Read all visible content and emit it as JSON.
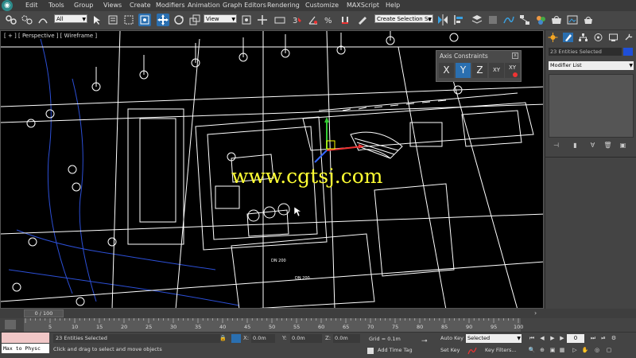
{
  "menu": [
    "Edit",
    "Tools",
    "Group",
    "Views",
    "Create",
    "Modifiers",
    "Animation",
    "Graph Editors",
    "Rendering",
    "Customize",
    "MAXScript",
    "Help"
  ],
  "toolbar": {
    "selection_filter": "All",
    "ref_coord": "View",
    "named_selection": "Create Selection Se"
  },
  "viewport": {
    "label": "[ + ] [ Perspective ] [ Wireframe ]",
    "watermark": "www.cgtsj.com",
    "annotations": [
      "DN 200",
      "DN 200"
    ]
  },
  "axis_constraints": {
    "title": "Axis Constraints",
    "close_glyph": "x",
    "buttons": [
      "X",
      "Y",
      "Z",
      "XY",
      "XY"
    ],
    "active": "Y"
  },
  "command_panel": {
    "object_name": "23 Entities Selected",
    "object_color": "#1f4fd8",
    "modifier_list": "Modifier List"
  },
  "timeline": {
    "slider": "0 / 100",
    "ticks": [
      "5",
      "10",
      "15",
      "20",
      "25",
      "30",
      "35",
      "40",
      "45",
      "50",
      "55",
      "60",
      "65",
      "70",
      "75",
      "80",
      "85",
      "90",
      "95",
      "100"
    ]
  },
  "status": {
    "maxscript_label": "Max to Physc",
    "selection": "23 Entities Selected",
    "prompt": "Click and drag to select and move objects",
    "x_label": "X:",
    "x_value": "0.0m",
    "y_label": "Y:",
    "y_value": "0.0m",
    "z_label": "Z:",
    "z_value": "0.0m",
    "grid": "Grid = 0.1m",
    "add_time_tag": "Add Time Tag",
    "auto_key": "Auto Key",
    "set_key": "Set Key",
    "key_mode": "Selected",
    "key_filters": "Key Filters...",
    "frame": "0"
  },
  "colors": {
    "accent_active": "#2a6fb0",
    "watermark": "#ffff33",
    "wireframe": "#ffffff",
    "contour": "#2c4fd6"
  }
}
